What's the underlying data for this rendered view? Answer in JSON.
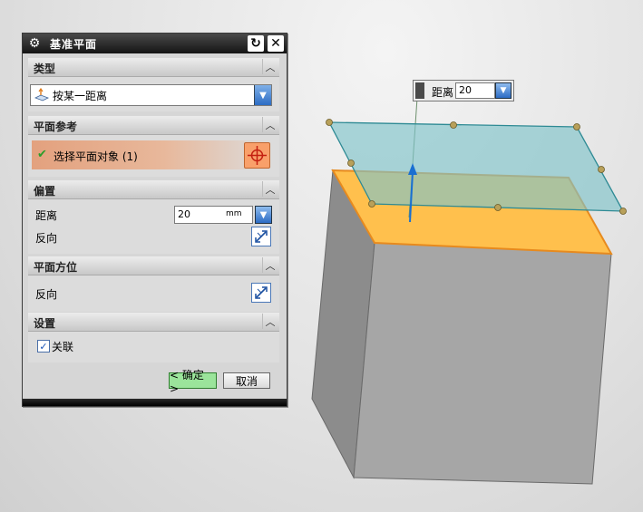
{
  "dialog": {
    "title": "基准平面",
    "sections": {
      "type": {
        "label": "类型",
        "selected": "按某一距离"
      },
      "reference": {
        "label": "平面参考",
        "select_text": "选择平面对象 (1)"
      },
      "offset": {
        "label": "偏置",
        "distance_label": "距离",
        "distance_value": "20",
        "unit": "mm",
        "reverse_label": "反向"
      },
      "orientation": {
        "label": "平面方位",
        "reverse_label": "反向"
      },
      "settings": {
        "label": "设置",
        "associative_label": "关联",
        "associative_checked": true
      }
    },
    "ok_label": "< 确定 >",
    "cancel_label": "取消"
  },
  "viewport_tag": {
    "label": "距离",
    "value": "20"
  },
  "colors": {
    "plane": "#7fc3c9",
    "top_face": "#ffc04d",
    "box_side": "#a6a6a6",
    "ok_button": "#9be49b",
    "select_accent": "#f9a06a"
  }
}
